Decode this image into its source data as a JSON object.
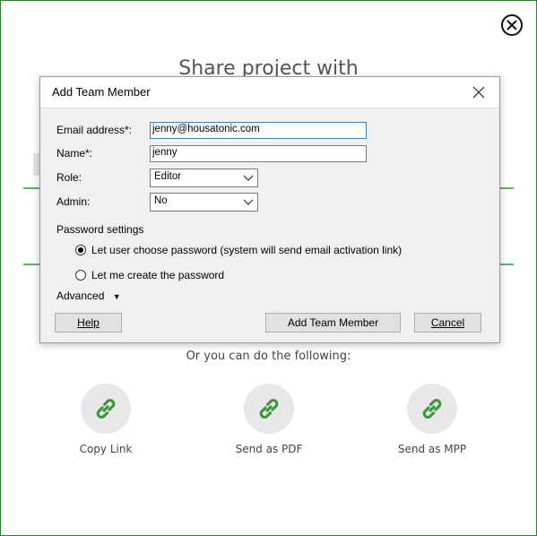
{
  "background": {
    "heading": "Share project with",
    "or_text": "Or you can do the following:",
    "actions": [
      {
        "label": "Copy Link",
        "icon": "link-icon"
      },
      {
        "label": "Send as PDF",
        "icon": "link-icon"
      },
      {
        "label": "Send as MPP",
        "icon": "link-icon"
      }
    ],
    "accent_color": "#5cb85c",
    "icon_color": "#3a9a3a"
  },
  "dialog": {
    "title": "Add Team Member",
    "email_label": "Email address*:",
    "email_value": "jenny@housatonic.com",
    "name_label": "Name*:",
    "name_value": "jenny",
    "role_label": "Role:",
    "role_value": "Editor",
    "admin_label": "Admin:",
    "admin_value": "No",
    "password_settings_label": "Password settings",
    "radio_option_1": "Let user choose password (system will send email activation link)",
    "radio_option_2": "Let me create the password",
    "selected_radio": 1,
    "advanced_label": "Advanced",
    "advanced_arrow": "▼",
    "help_button": "Help",
    "add_button": "Add Team Member",
    "cancel_button": "Cancel"
  }
}
